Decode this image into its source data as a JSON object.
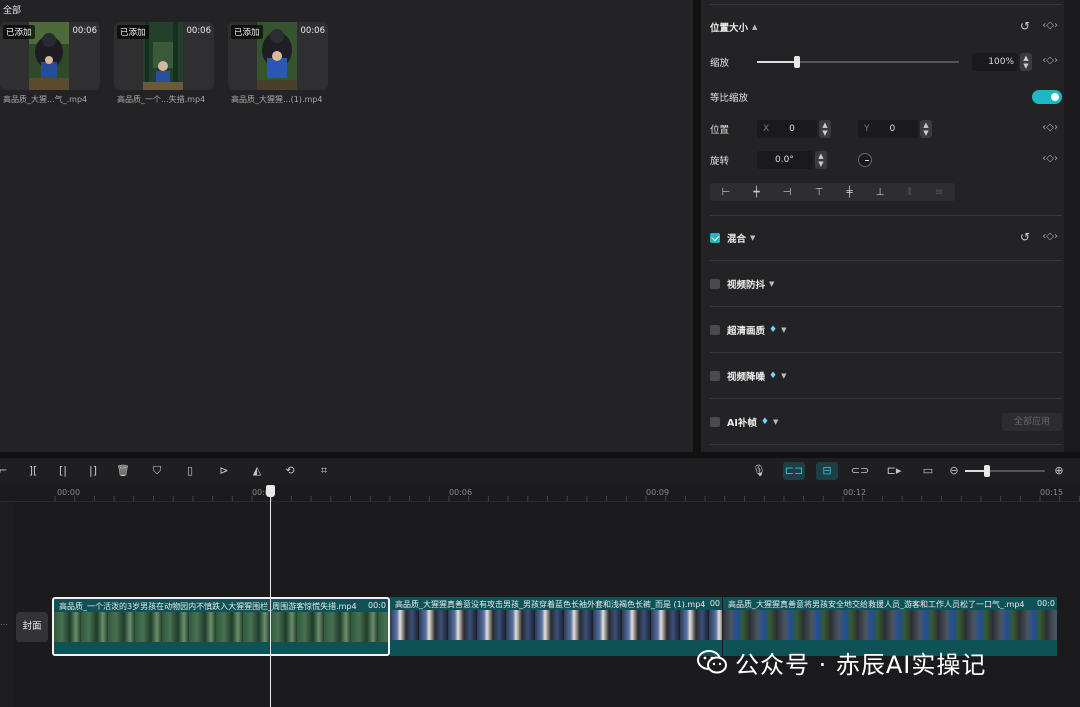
{
  "media": {
    "title": "全部",
    "items": [
      {
        "badge": "已添加",
        "duration": "00:06",
        "name": "高品质_大猩...气_.mp4"
      },
      {
        "badge": "已添加",
        "duration": "00:06",
        "name": "高品质_一个...失措.mp4"
      },
      {
        "badge": "已添加",
        "duration": "00:06",
        "name": "高品质_大猩猩...(1).mp4"
      }
    ]
  },
  "props": {
    "position_size": "位置大小",
    "scale_label": "缩放",
    "scale_value": "100%",
    "scale_fraction": 0.2,
    "uniform_scale": "等比缩放",
    "pos_label": "位置",
    "x_label": "X",
    "x_value": "0",
    "y_label": "Y",
    "y_value": "0",
    "rotate_label": "旋转",
    "rotate_value": "0.0°",
    "blend": "混合",
    "stabilize": "视频防抖",
    "hd": "超清画质",
    "denoise": "视频降噪",
    "ai_frame": "AI补帧",
    "apply_all": "全部应用"
  },
  "timeline": {
    "ticks": [
      "00:00",
      "00:03",
      "00:06",
      "00:09",
      "00:12",
      "00:15"
    ],
    "cover": "封面",
    "clips": [
      {
        "title": "高品质_一个活泼的3岁男孩在动物园内不慎跌入大猩猩围栏_周围游客惊慌失措.mp4",
        "time": "00:0"
      },
      {
        "title": "高品质_大猩猩真善意没有攻击男孩_男孩穿着蓝色长袖外套和浅褐色长裤_而是 (1).mp4",
        "time": "00"
      },
      {
        "title": "高品质_大猩猩真善意将男孩安全地交给救援人员_游客和工作人员松了一口气_.mp4",
        "time": "00:0"
      }
    ]
  },
  "watermark": "公众号 · 赤辰AI实操记"
}
